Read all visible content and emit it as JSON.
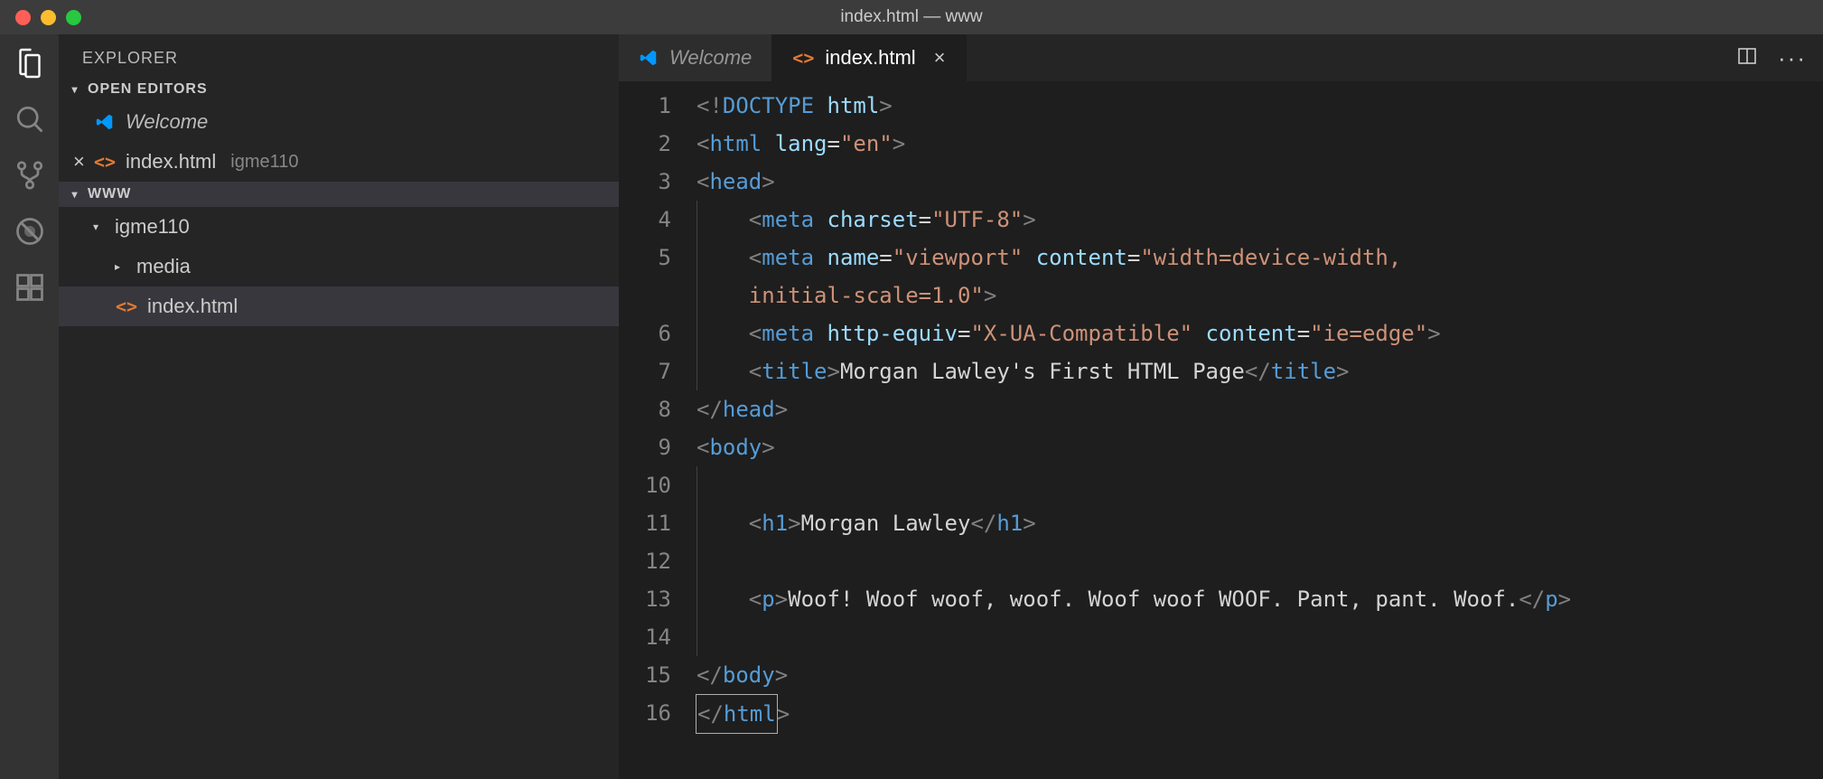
{
  "window": {
    "title": "index.html — www"
  },
  "sidebar": {
    "title": "EXPLORER",
    "openEditorsLabel": "OPEN EDITORS",
    "workspaceLabel": "WWW",
    "openEditors": [
      {
        "name": "Welcome",
        "italic": true,
        "icon": "vscode-logo"
      },
      {
        "name": "index.html",
        "dir": "igme110",
        "icon": "html-brackets",
        "closeable": true
      }
    ],
    "tree": [
      {
        "name": "igme110",
        "type": "folder",
        "expanded": true,
        "depth": 1
      },
      {
        "name": "media",
        "type": "folder",
        "expanded": false,
        "depth": 2
      },
      {
        "name": "index.html",
        "type": "file",
        "icon": "html-brackets",
        "depth": 2,
        "selected": true
      }
    ]
  },
  "tabs": [
    {
      "label": "Welcome",
      "icon": "vscode-logo",
      "italic": true,
      "active": false
    },
    {
      "label": "index.html",
      "icon": "html-brackets",
      "active": true,
      "closeable": true
    }
  ],
  "code": {
    "lines": [
      [
        {
          "t": "<",
          "c": "angle"
        },
        {
          "t": "!",
          "c": "angle"
        },
        {
          "t": "DOCTYPE ",
          "c": "doctype"
        },
        {
          "t": "html",
          "c": "attr"
        },
        {
          "t": ">",
          "c": "angle"
        }
      ],
      [
        {
          "t": "<",
          "c": "angle"
        },
        {
          "t": "html ",
          "c": "tag"
        },
        {
          "t": "lang",
          "c": "attr"
        },
        {
          "t": "=",
          "c": "text"
        },
        {
          "t": "\"en\"",
          "c": "str"
        },
        {
          "t": ">",
          "c": "angle"
        }
      ],
      [
        {
          "t": "<",
          "c": "angle"
        },
        {
          "t": "head",
          "c": "tag"
        },
        {
          "t": ">",
          "c": "angle"
        }
      ],
      [
        {
          "t": "    ",
          "c": "text"
        },
        {
          "t": "<",
          "c": "angle"
        },
        {
          "t": "meta ",
          "c": "tag"
        },
        {
          "t": "charset",
          "c": "attr"
        },
        {
          "t": "=",
          "c": "text"
        },
        {
          "t": "\"UTF-8\"",
          "c": "str"
        },
        {
          "t": ">",
          "c": "angle"
        }
      ],
      [
        {
          "t": "    ",
          "c": "text"
        },
        {
          "t": "<",
          "c": "angle"
        },
        {
          "t": "meta ",
          "c": "tag"
        },
        {
          "t": "name",
          "c": "attr"
        },
        {
          "t": "=",
          "c": "text"
        },
        {
          "t": "\"viewport\" ",
          "c": "str"
        },
        {
          "t": "content",
          "c": "attr"
        },
        {
          "t": "=",
          "c": "text"
        },
        {
          "t": "\"width=device-width, ",
          "c": "str"
        }
      ],
      [
        {
          "t": "    ",
          "c": "text"
        },
        {
          "t": "initial-scale=1.0\"",
          "c": "str"
        },
        {
          "t": ">",
          "c": "angle"
        }
      ],
      [
        {
          "t": "    ",
          "c": "text"
        },
        {
          "t": "<",
          "c": "angle"
        },
        {
          "t": "meta ",
          "c": "tag"
        },
        {
          "t": "http-equiv",
          "c": "attr"
        },
        {
          "t": "=",
          "c": "text"
        },
        {
          "t": "\"X-UA-Compatible\" ",
          "c": "str"
        },
        {
          "t": "content",
          "c": "attr"
        },
        {
          "t": "=",
          "c": "text"
        },
        {
          "t": "\"ie=edge\"",
          "c": "str"
        },
        {
          "t": ">",
          "c": "angle"
        }
      ],
      [
        {
          "t": "    ",
          "c": "text"
        },
        {
          "t": "<",
          "c": "angle"
        },
        {
          "t": "title",
          "c": "tag"
        },
        {
          "t": ">",
          "c": "angle"
        },
        {
          "t": "Morgan Lawley's First HTML Page",
          "c": "text"
        },
        {
          "t": "</",
          "c": "angle"
        },
        {
          "t": "title",
          "c": "tag"
        },
        {
          "t": ">",
          "c": "angle"
        }
      ],
      [
        {
          "t": "</",
          "c": "angle"
        },
        {
          "t": "head",
          "c": "tag"
        },
        {
          "t": ">",
          "c": "angle"
        }
      ],
      [
        {
          "t": "<",
          "c": "angle"
        },
        {
          "t": "body",
          "c": "tag"
        },
        {
          "t": ">",
          "c": "angle"
        }
      ],
      [
        {
          "t": "",
          "c": "text"
        }
      ],
      [
        {
          "t": "    ",
          "c": "text"
        },
        {
          "t": "<",
          "c": "angle"
        },
        {
          "t": "h1",
          "c": "tag"
        },
        {
          "t": ">",
          "c": "angle"
        },
        {
          "t": "Morgan Lawley",
          "c": "text"
        },
        {
          "t": "</",
          "c": "angle"
        },
        {
          "t": "h1",
          "c": "tag"
        },
        {
          "t": ">",
          "c": "angle"
        }
      ],
      [
        {
          "t": "",
          "c": "text"
        }
      ],
      [
        {
          "t": "    ",
          "c": "text"
        },
        {
          "t": "<",
          "c": "angle"
        },
        {
          "t": "p",
          "c": "tag"
        },
        {
          "t": ">",
          "c": "angle"
        },
        {
          "t": "Woof! Woof woof, woof. Woof woof WOOF. Pant, pant. Woof.",
          "c": "text"
        },
        {
          "t": "</",
          "c": "angle"
        },
        {
          "t": "p",
          "c": "tag"
        },
        {
          "t": ">",
          "c": "angle"
        }
      ],
      [
        {
          "t": "",
          "c": "text"
        }
      ],
      [
        {
          "t": "</",
          "c": "angle"
        },
        {
          "t": "body",
          "c": "tag"
        },
        {
          "t": ">",
          "c": "angle"
        }
      ],
      [
        {
          "t": "CURSOR_OPEN",
          "c": "cursor"
        },
        {
          "t": "</",
          "c": "angle"
        },
        {
          "t": "html",
          "c": "tag"
        },
        {
          "t": "CURSOR_CLOSE",
          "c": "cursor"
        },
        {
          "t": ">",
          "c": "angle"
        }
      ]
    ],
    "lineNumbers": [
      "1",
      "2",
      "3",
      "4",
      "5",
      "",
      "6",
      "7",
      "8",
      "9",
      "10",
      "11",
      "12",
      "13",
      "14",
      "15",
      "16"
    ]
  }
}
